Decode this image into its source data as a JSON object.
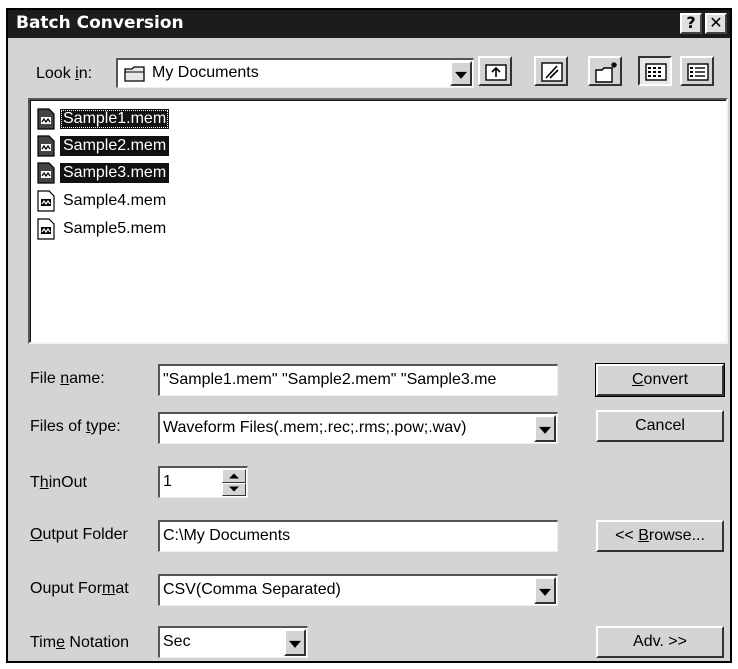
{
  "window": {
    "title": "Batch Conversion",
    "help_label": "?",
    "close_label": "✕"
  },
  "lookin": {
    "label_pre": "Look ",
    "label_key": "i",
    "label_post": "n:",
    "value": "My Documents",
    "icon": "folder-icon"
  },
  "toolbar": {
    "icons": [
      "up-one-level-icon",
      "desktop-icon",
      "new-folder-icon",
      "list-view-icon",
      "details-view-icon"
    ]
  },
  "files": [
    {
      "name": "Sample1.mem",
      "selected": true,
      "focused": true
    },
    {
      "name": "Sample2.mem",
      "selected": true,
      "focused": false
    },
    {
      "name": "Sample3.mem",
      "selected": true,
      "focused": false
    },
    {
      "name": "Sample4.mem",
      "selected": false,
      "focused": false
    },
    {
      "name": "Sample5.mem",
      "selected": false,
      "focused": false
    }
  ],
  "form": {
    "filename": {
      "label_pre": "File ",
      "label_key": "n",
      "label_post": "ame:",
      "value": "\"Sample1.mem\" \"Sample2.mem\" \"Sample3.me"
    },
    "filetype": {
      "label_pre": "Files of ",
      "label_key": "t",
      "label_post": "ype:",
      "value": "Waveform Files(.mem;.rec;.rms;.pow;.wav)"
    },
    "thinout": {
      "label_pre": "T",
      "label_key": "h",
      "label_post": "inOut",
      "value": "1"
    },
    "output_folder": {
      "label_pre": "",
      "label_key": "O",
      "label_post": "utput Folder",
      "value": "C:\\My Documents"
    },
    "output_format": {
      "label_pre": "Ouput For",
      "label_key": "m",
      "label_post": "at",
      "value": "CSV(Comma Separated)"
    },
    "time_notation": {
      "label_pre": "Tim",
      "label_key": "e",
      "label_post": " Notation",
      "value": "Sec"
    }
  },
  "buttons": {
    "convert": {
      "pre": "",
      "key": "C",
      "post": "onvert"
    },
    "cancel": "Cancel",
    "browse": {
      "pre": "<< ",
      "key": "B",
      "post": "rowse..."
    },
    "advanced": "Adv. >>"
  }
}
